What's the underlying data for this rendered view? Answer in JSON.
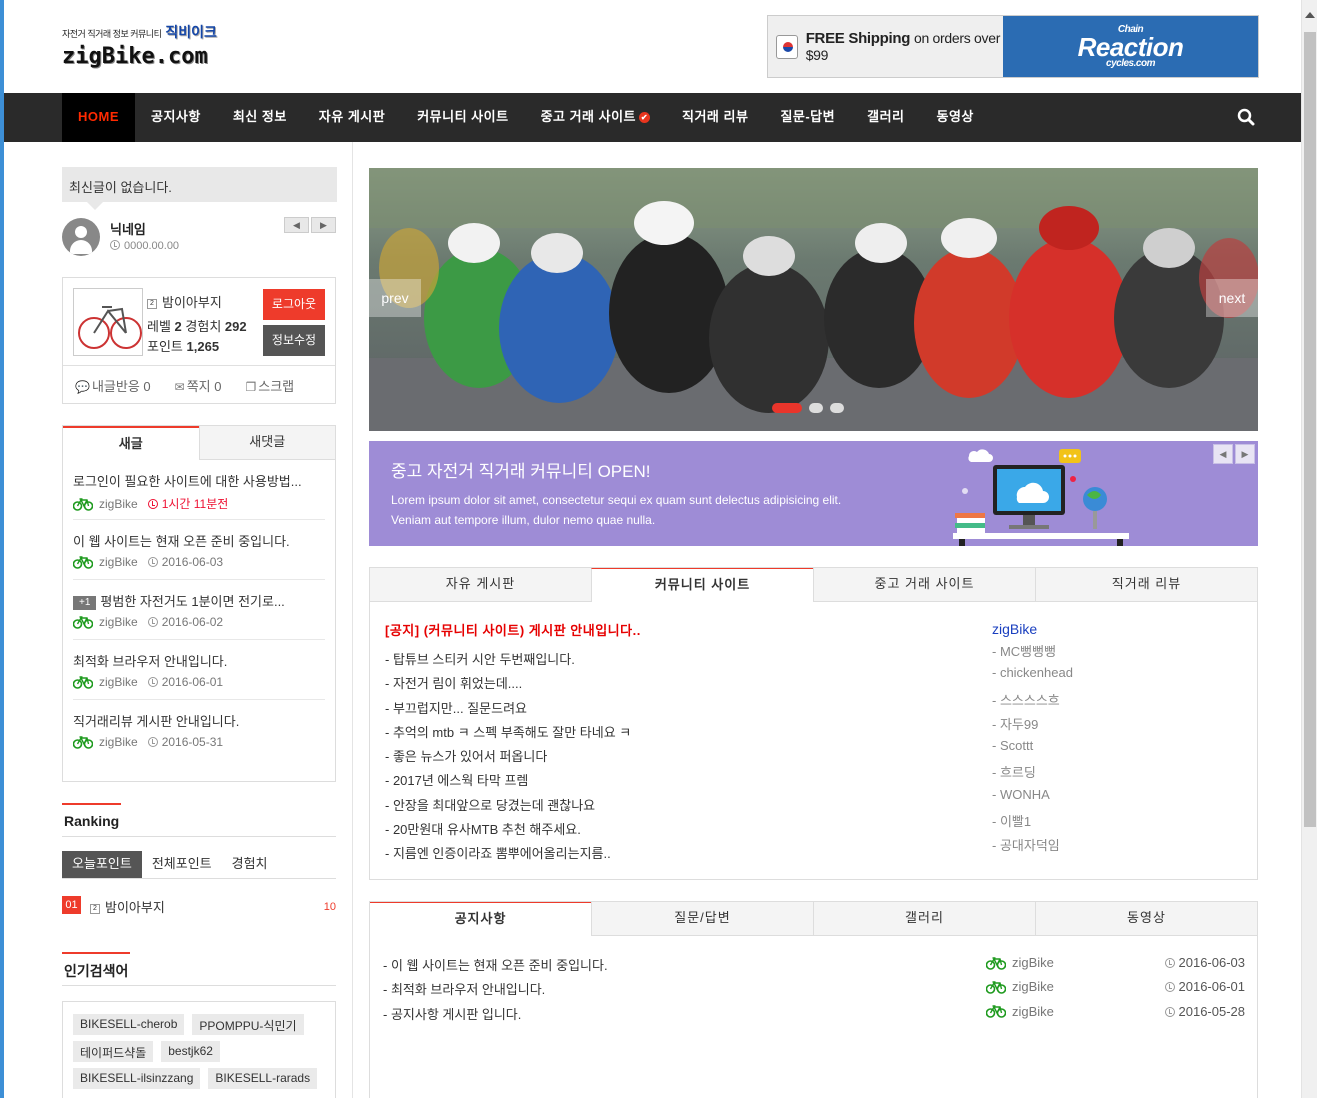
{
  "header": {
    "logo_small": "자전거 직거래 정보 커뮤니티",
    "logo_korean": "직비이크",
    "logo_main": "zigBike.com",
    "ad_free": "FREE Shipping",
    "ad_orders": "on orders over $99",
    "ad_brand_top": "Chain",
    "ad_brand_mid": "Reaction",
    "ad_brand_bottom": "cycles.com"
  },
  "nav": {
    "items": [
      "HOME",
      "공지사항",
      "최신 정보",
      "자유 게시판",
      "커뮤니티 사이트",
      "중고 거래 사이트",
      "직거래 리뷰",
      "질문-답변",
      "갤러리",
      "동영상"
    ],
    "check_glyph": "✔",
    "search_icon": "search-icon"
  },
  "sidebar": {
    "recent_notice": "최신글이 없습니다.",
    "user": {
      "nick": "닉네임",
      "date": "0000.00.00"
    },
    "profile": {
      "name": "밤이아부지",
      "level_label": "레벨",
      "level": "2",
      "exp_label": "경험치",
      "exp": "292",
      "point_label": "포인트",
      "point": "1,265",
      "logout": "로그아웃",
      "edit": "정보수정",
      "reactions": "내글반응 0",
      "memo": "쪽지 0",
      "scrap": "스크랩"
    },
    "post_tabs": [
      "새글",
      "새댓글"
    ],
    "posts": [
      {
        "title": "로그인이 필요한 사이트에 대한 사용방법...",
        "author": "zigBike",
        "time": "1시간 11분전",
        "recent": true,
        "badge": ""
      },
      {
        "title": "이 웹 사이트는 현재 오픈 준비 중입니다.",
        "author": "zigBike",
        "time": "2016-06-03",
        "recent": false,
        "badge": ""
      },
      {
        "title": "평범한 자전거도 1분이면 전기로...",
        "author": "zigBike",
        "time": "2016-06-02",
        "recent": false,
        "badge": "+1"
      },
      {
        "title": "최적화 브라우저 안내입니다.",
        "author": "zigBike",
        "time": "2016-06-01",
        "recent": false,
        "badge": ""
      },
      {
        "title": "직거래리뷰 게시판 안내입니다.",
        "author": "zigBike",
        "time": "2016-05-31",
        "recent": false,
        "badge": ""
      }
    ],
    "ranking": {
      "title": "Ranking",
      "tabs": [
        "오늘포인트",
        "전체포인트",
        "경험치"
      ],
      "rows": [
        {
          "no": "01",
          "name": "밤이아부지",
          "value": "10"
        }
      ]
    },
    "popular": {
      "title": "인기검색어",
      "tags": [
        "BIKESELL-cherob",
        "PPOMPPU-식민기",
        "테이퍼드샥돌",
        "bestjk62",
        "BIKESELL-ilsinzzang",
        "BIKESELL-rarads"
      ]
    }
  },
  "slider": {
    "prev": "prev",
    "next": "next",
    "dots": 3,
    "active_dot": 0
  },
  "banner": {
    "heading": "중고 자전거 직거래 커뮤니티 OPEN!",
    "line1": "Lorem ipsum dolor sit amet, consectetur sequi ex quam sunt delectus adipisicing elit.",
    "line2": "Veniam aut tempore illum, dulor nemo quae nulla."
  },
  "board": {
    "tabs": [
      "자유 게시판",
      "커뮤니티 사이트",
      "중고 거래 사이트",
      "직거래 리뷰"
    ],
    "active_tab": 1,
    "notice": "[공지] (커뮤니티 사이트) 게시판 안내입니다..",
    "posts": [
      "- 탑튜브 스티커 시안 두번째입니다.",
      "- 자전거 림이 휘었는데....",
      "- 부끄럽지만... 질문드려요",
      "- 추억의 mtb ㅋ 스펙 부족해도 잘만 타네요 ㅋ",
      "- 좋은 뉴스가 있어서 퍼옵니다",
      "- 2017년 에스웍 타막 프렘",
      "- 안장을 최대앞으로 당겼는데 괜찮나요",
      "- 20만원대 유사MTB 추천 해주세요.",
      "- 지름엔 인증이라죠 뽐뿌에어올리는지름.."
    ],
    "site": "zigBike",
    "authors": [
      "- MC뻥뻥뻥",
      "- chickenhead",
      "- 스스스스흐",
      "- 자두99",
      "- Scottt",
      "- 흐르딩",
      "- WONHA",
      "- 이빨1",
      "- 공대자덕임"
    ]
  },
  "notice_board": {
    "tabs": [
      "공지사항",
      "질문/답변",
      "갤러리",
      "동영상"
    ],
    "active_tab": 0,
    "rows": [
      {
        "title": "- 이 웹 사이트는 현재 오픈 준비 중입니다.",
        "author": "zigBike",
        "date": "2016-06-03"
      },
      {
        "title": "- 최적화 브라우저 안내입니다.",
        "author": "zigBike",
        "date": "2016-06-01"
      },
      {
        "title": "- 공지사항 게시판 입니다.",
        "author": "zigBike",
        "date": "2016-05-28"
      }
    ]
  },
  "colors": {
    "accent": "#ee3b2b",
    "nav_bg": "#2a2a2a",
    "banner_bg": "#9e8cd6",
    "link_blue": "#1a3fbf"
  }
}
